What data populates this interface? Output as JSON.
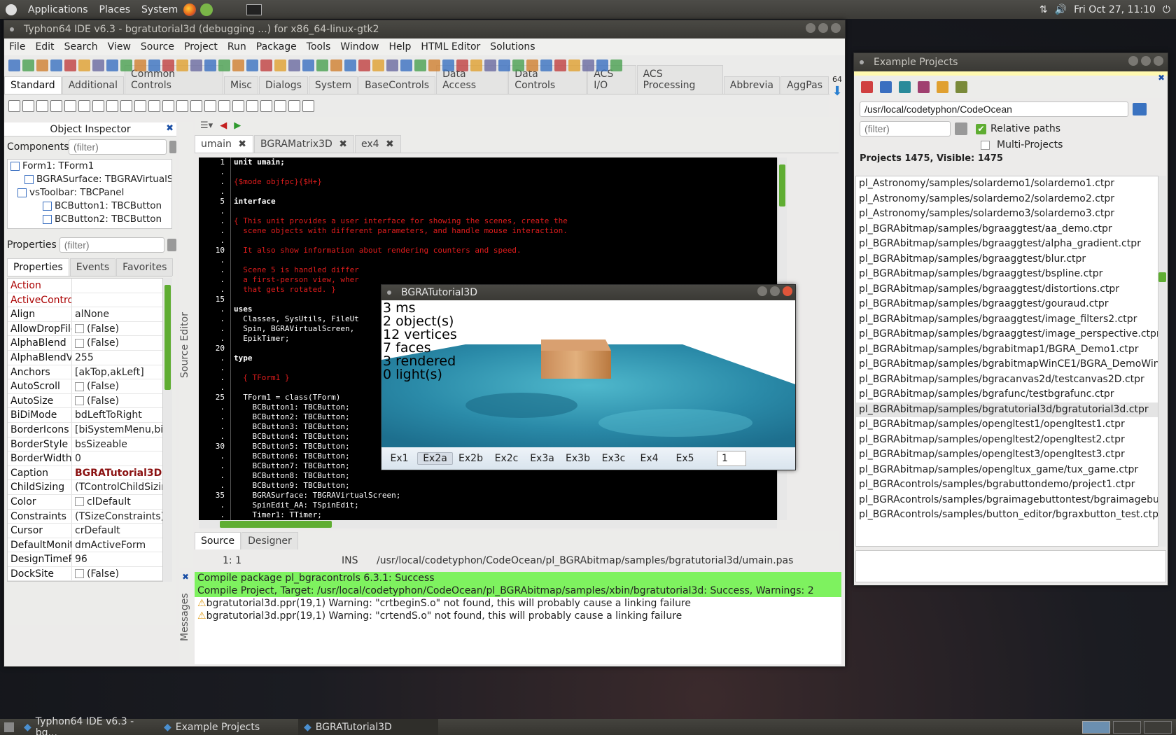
{
  "top_panel": {
    "menus": [
      "Applications",
      "Places",
      "System"
    ],
    "clock": "Fri Oct 27, 11:10"
  },
  "ide": {
    "title": "Typhon64 IDE v6.3 - bgratutorial3d (debugging ...) for x86_64-linux-gtk2",
    "menus": [
      "File",
      "Edit",
      "Search",
      "View",
      "Source",
      "Project",
      "Run",
      "Package",
      "Tools",
      "Window",
      "Help",
      "HTML Editor",
      "Solutions"
    ],
    "palette_tabs": [
      "Standard",
      "Additional",
      "Common Controls",
      "Misc",
      "Dialogs",
      "System",
      "BaseControls",
      "Data Access",
      "Data Controls",
      "ACS I/O",
      "ACS Processing",
      "Abbrevia",
      "AggPas"
    ],
    "arch_label": "64",
    "inspector": {
      "title": "Object Inspector",
      "components_label": "Components",
      "filter_placeholder": "(filter)",
      "tree": [
        "Form1: TForm1",
        "BGRASurface: TBGRAVirtualS",
        "vsToolbar: TBCPanel",
        "BCButton1: TBCButton",
        "BCButton2: TBCButton",
        "BCButton3: TBCButton"
      ],
      "properties_label": "Properties",
      "tabs": [
        "Properties",
        "Events",
        "Favorites"
      ],
      "props": [
        {
          "name": "Action",
          "value": ""
        },
        {
          "name": "ActiveControl",
          "value": ""
        },
        {
          "name": "Align",
          "value": "alNone"
        },
        {
          "name": "AllowDropFiles",
          "value": "(False)"
        },
        {
          "name": "AlphaBlend",
          "value": "(False)"
        },
        {
          "name": "AlphaBlendValue",
          "value": "255"
        },
        {
          "name": "Anchors",
          "value": "[akTop,akLeft]"
        },
        {
          "name": "AutoScroll",
          "value": "(False)"
        },
        {
          "name": "AutoSize",
          "value": "(False)"
        },
        {
          "name": "BiDiMode",
          "value": "bdLeftToRight"
        },
        {
          "name": "BorderIcons",
          "value": "[biSystemMenu,biMinimize"
        },
        {
          "name": "BorderStyle",
          "value": "bsSizeable"
        },
        {
          "name": "BorderWidth",
          "value": "0"
        },
        {
          "name": "Caption",
          "value": "BGRATutorial3D"
        },
        {
          "name": "ChildSizing",
          "value": "(TControlChildSizing)"
        },
        {
          "name": "Color",
          "value": "clDefault"
        },
        {
          "name": "Constraints",
          "value": "(TSizeConstraints)"
        },
        {
          "name": "Cursor",
          "value": "crDefault"
        },
        {
          "name": "DefaultMonitor",
          "value": "dmActiveForm"
        },
        {
          "name": "DesignTimePPI",
          "value": "96"
        },
        {
          "name": "DockSite",
          "value": "(False)"
        }
      ]
    },
    "editor": {
      "tabs": [
        "umain",
        "BGRAMatrix3D",
        "ex4"
      ],
      "side_label": "Source Editor",
      "bottom_tabs": [
        "Source",
        "Designer"
      ],
      "status": {
        "pos": "1:  1",
        "mode": "INS",
        "file": "/usr/local/codetyphon/CodeOcean/pl_BGRAbitmap/samples/bgratutorial3d/umain.pas"
      },
      "lines": [
        {
          "n": "1",
          "t": "unit umain;",
          "c": "kw"
        },
        {
          "n": ".",
          "t": "",
          "c": ""
        },
        {
          "n": ".",
          "t": "{$mode objfpc}{$H+}",
          "c": "dir"
        },
        {
          "n": ".",
          "t": "",
          "c": ""
        },
        {
          "n": "5",
          "t": "interface",
          "c": "kw"
        },
        {
          "n": ".",
          "t": "",
          "c": ""
        },
        {
          "n": ".",
          "t": "{ This unit provides a user interface for showing the scenes, create the",
          "c": "cm"
        },
        {
          "n": ".",
          "t": "  scene objects with different parameters, and handle mouse interaction.",
          "c": "cm"
        },
        {
          "n": ".",
          "t": "",
          "c": ""
        },
        {
          "n": "10",
          "t": "  It also show information about rendering counters and speed.",
          "c": "cm"
        },
        {
          "n": ".",
          "t": "",
          "c": ""
        },
        {
          "n": ".",
          "t": "  Scene 5 is handled differ",
          "c": "cm"
        },
        {
          "n": ".",
          "t": "  a first-person view, wher",
          "c": "cm"
        },
        {
          "n": ".",
          "t": "  that gets rotated. }",
          "c": "cm"
        },
        {
          "n": "15",
          "t": "",
          "c": ""
        },
        {
          "n": ".",
          "t": "uses",
          "c": "kw"
        },
        {
          "n": ".",
          "t": "  Classes, SysUtils, FileUt",
          "c": ""
        },
        {
          "n": ".",
          "t": "  Spin, BGRAVirtualScreen,",
          "c": ""
        },
        {
          "n": ".",
          "t": "  EpikTimer;",
          "c": ""
        },
        {
          "n": "20",
          "t": "",
          "c": ""
        },
        {
          "n": ".",
          "t": "type",
          "c": "kw"
        },
        {
          "n": ".",
          "t": "",
          "c": ""
        },
        {
          "n": ".",
          "t": "  { TForm1 }",
          "c": "cm"
        },
        {
          "n": ".",
          "t": "",
          "c": ""
        },
        {
          "n": "25",
          "t": "  TForm1 = class(TForm)",
          "c": ""
        },
        {
          "n": ".",
          "t": "    BCButton1: TBCButton;",
          "c": ""
        },
        {
          "n": ".",
          "t": "    BCButton2: TBCButton;",
          "c": ""
        },
        {
          "n": ".",
          "t": "    BCButton3: TBCButton;",
          "c": ""
        },
        {
          "n": ".",
          "t": "    BCButton4: TBCButton;",
          "c": ""
        },
        {
          "n": "30",
          "t": "    BCButton5: TBCButton;",
          "c": ""
        },
        {
          "n": ".",
          "t": "    BCButton6: TBCButton;",
          "c": ""
        },
        {
          "n": ".",
          "t": "    BCButton7: TBCButton;",
          "c": ""
        },
        {
          "n": ".",
          "t": "    BCButton8: TBCButton;",
          "c": ""
        },
        {
          "n": ".",
          "t": "    BCButton9: TBCButton;",
          "c": ""
        },
        {
          "n": "35",
          "t": "    BGRASurface: TBGRAVirtualScreen;",
          "c": ""
        },
        {
          "n": ".",
          "t": "    SpinEdit_AA: TSpinEdit;",
          "c": ""
        },
        {
          "n": ".",
          "t": "    Timer1: TTimer;",
          "c": ""
        }
      ]
    },
    "messages": {
      "side_label": "Messages",
      "items": [
        {
          "text": "Compile package pl_bgracontrols 6.3.1: Success",
          "type": "ok"
        },
        {
          "text": "Compile Project, Target: /usr/local/codetyphon/CodeOcean/pl_BGRAbitmap/samples/xbin/bgratutorial3d: Success, Warnings: 2",
          "type": "ok"
        },
        {
          "text": "bgratutorial3d.ppr(19,1) Warning: \"crtbeginS.o\" not found, this will probably cause a linking failure",
          "type": "warn"
        },
        {
          "text": "bgratutorial3d.ppr(19,1) Warning: \"crtendS.o\" not found, this will probably cause a linking failure",
          "type": "warn"
        }
      ]
    }
  },
  "examples": {
    "title": "Example Projects",
    "path": "/usr/local/codetyphon/CodeOcean",
    "filter_placeholder": "(filter)",
    "relative_paths_label": "Relative paths",
    "relative_paths_checked": true,
    "multi_projects_label": "Multi-Projects",
    "multi_projects_checked": false,
    "count_label": "Projects 1475, Visible: 1475",
    "projects": [
      "pl_Astronomy/samples/solardemo1/solardemo1.ctpr",
      "pl_Astronomy/samples/solardemo2/solardemo2.ctpr",
      "pl_Astronomy/samples/solardemo3/solardemo3.ctpr",
      "pl_BGRAbitmap/samples/bgraaggtest/aa_demo.ctpr",
      "pl_BGRAbitmap/samples/bgraaggtest/alpha_gradient.ctpr",
      "pl_BGRAbitmap/samples/bgraaggtest/blur.ctpr",
      "pl_BGRAbitmap/samples/bgraaggtest/bspline.ctpr",
      "pl_BGRAbitmap/samples/bgraaggtest/distortions.ctpr",
      "pl_BGRAbitmap/samples/bgraaggtest/gouraud.ctpr",
      "pl_BGRAbitmap/samples/bgraaggtest/image_filters2.ctpr",
      "pl_BGRAbitmap/samples/bgraaggtest/image_perspective.ctpr",
      "pl_BGRAbitmap/samples/bgrabitmap1/BGRA_Demo1.ctpr",
      "pl_BGRAbitmap/samples/bgrabitmapWinCE1/BGRA_DemoWinCE",
      "pl_BGRAbitmap/samples/bgracanvas2d/testcanvas2D.ctpr",
      "pl_BGRAbitmap/samples/bgrafunc/testbgrafunc.ctpr",
      "pl_BGRAbitmap/samples/bgratutorial3d/bgratutorial3d.ctpr",
      "pl_BGRAbitmap/samples/opengltest1/opengltest1.ctpr",
      "pl_BGRAbitmap/samples/opengltest2/opengltest2.ctpr",
      "pl_BGRAbitmap/samples/opengltest3/opengltest3.ctpr",
      "pl_BGRAbitmap/samples/opengltux_game/tux_game.ctpr",
      "pl_BGRAcontrols/samples/bgrabuttondemo/project1.ctpr",
      "pl_BGRAcontrols/samples/bgraimagebuttontest/bgraimagebuttontest",
      "pl_BGRAcontrols/samples/button_editor/bgraxbutton_test.ctpr"
    ],
    "selected_index": 15
  },
  "tutorial": {
    "title": "BGRATutorial3D",
    "info": [
      "3 ms",
      "2 object(s)",
      "12 vertices",
      "7 faces",
      "3 rendered",
      "0 light(s)"
    ],
    "buttons": [
      "Ex1",
      "Ex2a",
      "Ex2b",
      "Ex2c",
      "Ex3a",
      "Ex3b",
      "Ex3c",
      "Ex4",
      "Ex5"
    ],
    "active_button": "Ex2a",
    "spin_value": "1"
  },
  "taskbar": [
    "Typhon64 IDE v6.3 - bg...",
    "Example Projects",
    "BGRATutorial3D"
  ],
  "colors": {
    "accent_green": "#5fad32",
    "msg_green": "#7ef25f",
    "code_bg": "#000000",
    "comment_red": "#e01d1d",
    "water": "#2a8aa8"
  }
}
